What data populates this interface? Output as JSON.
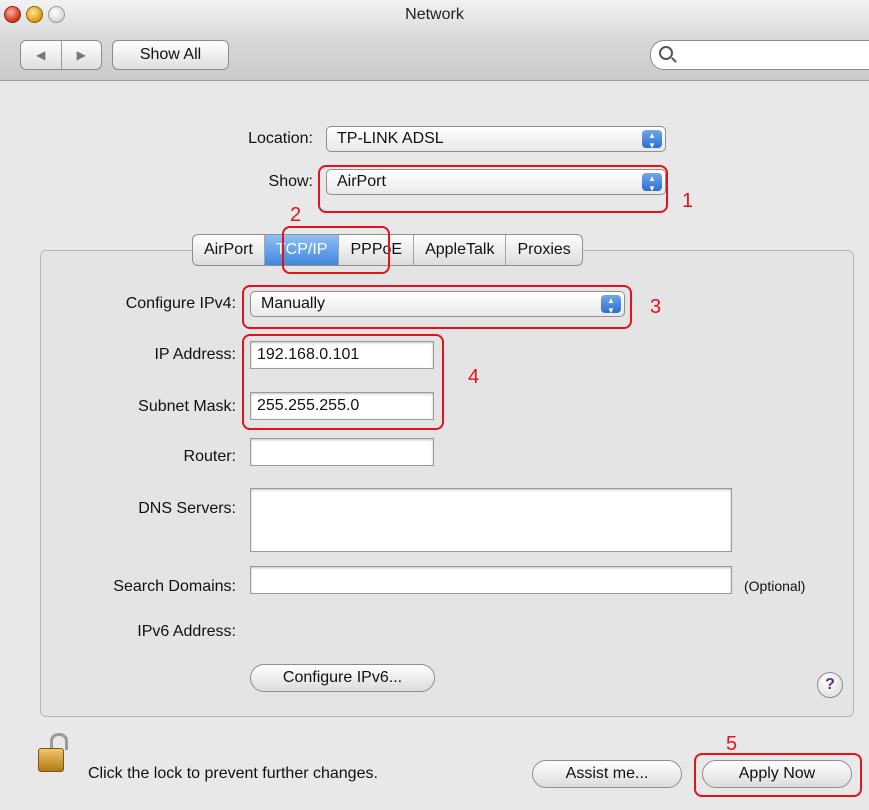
{
  "window": {
    "title": "Network"
  },
  "toolbar": {
    "back": "◀",
    "forward": "▶",
    "show_all": "Show All",
    "search_placeholder": ""
  },
  "location": {
    "label": "Location:",
    "value": "TP-LINK ADSL"
  },
  "show": {
    "label": "Show:",
    "value": "AirPort"
  },
  "tabs": [
    {
      "label": "AirPort"
    },
    {
      "label": "TCP/IP",
      "selected": true
    },
    {
      "label": "PPPoE"
    },
    {
      "label": "AppleTalk"
    },
    {
      "label": "Proxies"
    }
  ],
  "configure_ipv4": {
    "label": "Configure IPv4:",
    "value": "Manually"
  },
  "ip_address": {
    "label": "IP Address:",
    "value": "192.168.0.101"
  },
  "subnet_mask": {
    "label": "Subnet Mask:",
    "value": "255.255.255.0"
  },
  "router": {
    "label": "Router:",
    "value": ""
  },
  "dns_servers": {
    "label": "DNS Servers:",
    "value": ""
  },
  "search_domains": {
    "label": "Search Domains:",
    "value": "",
    "note": "(Optional)"
  },
  "ipv6": {
    "label": "IPv6 Address:",
    "button": "Configure IPv6..."
  },
  "help": {
    "label": "?"
  },
  "footer": {
    "lock_text": "Click the lock to prevent further changes.",
    "assist": "Assist me...",
    "apply": "Apply Now"
  },
  "annotations": [
    "1",
    "2",
    "3",
    "4",
    "5"
  ],
  "colors": {
    "annotation": "#e3121b",
    "tab_selected": "#3f86dc"
  }
}
